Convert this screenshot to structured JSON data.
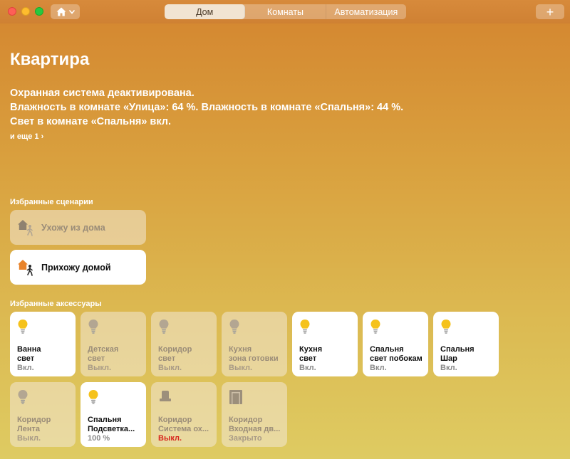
{
  "toolbar": {
    "tabs": [
      {
        "label": "Дом",
        "active": true
      },
      {
        "label": "Комнаты",
        "active": false
      },
      {
        "label": "Автоматизация",
        "active": false
      }
    ],
    "add_label": "+"
  },
  "home": {
    "title": "Квартира",
    "status": [
      "Охранная система деактивирована.",
      "Влажность в комнате «Улица»: 64 %. Влажность в комнате «Спальня»: 44 %.",
      "Свет в комнате «Спальня» вкл."
    ],
    "more": "и еще 1 ›"
  },
  "scenes": {
    "label": "Избранные сценарии",
    "items": [
      {
        "label": "Ухожу из дома",
        "on": false
      },
      {
        "label": "Прихожу домой",
        "on": true
      }
    ]
  },
  "accessories": {
    "label": "Избранные аксессуары",
    "items": [
      {
        "room": "Ванна",
        "name": "свет",
        "status": "Вкл.",
        "on": true,
        "icon": "lightbulb-icon"
      },
      {
        "room": "Детская",
        "name": "свет",
        "status": "Выкл.",
        "on": false,
        "icon": "lightbulb-icon"
      },
      {
        "room": "Коридор",
        "name": "свет",
        "status": "Выкл.",
        "on": false,
        "icon": "lightbulb-icon"
      },
      {
        "room": "Кухня",
        "name": "зона готовки",
        "status": "Выкл.",
        "on": false,
        "icon": "lightbulb-icon"
      },
      {
        "room": "Кухня",
        "name": "свет",
        "status": "Вкл.",
        "on": true,
        "icon": "lightbulb-icon"
      },
      {
        "room": "Спальня",
        "name": "свет побокам",
        "status": "Вкл.",
        "on": true,
        "icon": "lightbulb-icon"
      },
      {
        "room": "Спальня",
        "name": "Шар",
        "status": "Вкл.",
        "on": true,
        "icon": "lightbulb-icon"
      },
      {
        "room": "Коридор",
        "name": "Лента",
        "status": "Выкл.",
        "on": false,
        "icon": "lightbulb-icon"
      },
      {
        "room": "Спальня",
        "name": "Подсветка...",
        "status": "100 %",
        "on": true,
        "icon": "lightbulb-icon"
      },
      {
        "room": "Коридор",
        "name": "Система ох...",
        "status": "Выкл.",
        "on": false,
        "icon": "alarm-siren-icon",
        "alert": true
      },
      {
        "room": "Коридор",
        "name": "Входная дв...",
        "status": "Закрыто",
        "on": false,
        "icon": "door-icon"
      }
    ]
  },
  "colors": {
    "bulb_on": "#f5c21b",
    "bulb_off": "#b3a692",
    "alert": "#d7261e"
  }
}
